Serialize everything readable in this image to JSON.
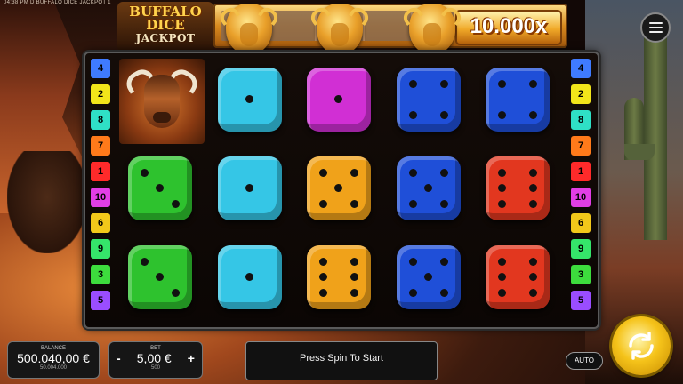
{
  "status_text": "04:38 PM  D  BUFFALO DICE JACKPOT  1",
  "logo": {
    "line1": "BUFFALO",
    "line2": "DICE",
    "line3": "JACKPOT"
  },
  "jackpot": {
    "value": "10.000x"
  },
  "paytable_left": [
    {
      "value": "4",
      "color": "#3f7bff"
    },
    {
      "value": "2",
      "color": "#f2e51a"
    },
    {
      "value": "8",
      "color": "#2fe0c6"
    },
    {
      "value": "7",
      "color": "#ff7a1a"
    },
    {
      "value": "1",
      "color": "#ff2a2a"
    },
    {
      "value": "10",
      "color": "#e23ee6"
    },
    {
      "value": "6",
      "color": "#f2c81a"
    },
    {
      "value": "9",
      "color": "#35e56a"
    },
    {
      "value": "3",
      "color": "#3ddc3d"
    },
    {
      "value": "5",
      "color": "#9a4dff"
    }
  ],
  "paytable_right": [
    {
      "value": "4",
      "color": "#3f7bff"
    },
    {
      "value": "2",
      "color": "#f2e51a"
    },
    {
      "value": "8",
      "color": "#2fe0c6"
    },
    {
      "value": "7",
      "color": "#ff7a1a"
    },
    {
      "value": "1",
      "color": "#ff2a2a"
    },
    {
      "value": "10",
      "color": "#e23ee6"
    },
    {
      "value": "6",
      "color": "#f2c81a"
    },
    {
      "value": "9",
      "color": "#35e56a"
    },
    {
      "value": "3",
      "color": "#3ddc3d"
    },
    {
      "value": "5",
      "color": "#9a4dff"
    }
  ],
  "grid": [
    [
      {
        "type": "buffalo"
      },
      {
        "type": "die",
        "color": "cyan",
        "pips": 1
      },
      {
        "type": "die",
        "color": "magenta",
        "pips": 1
      },
      {
        "type": "die",
        "color": "blue",
        "pips": 4
      },
      {
        "type": "die",
        "color": "blue",
        "pips": 4
      }
    ],
    [
      {
        "type": "die",
        "color": "green",
        "pips": 3
      },
      {
        "type": "die",
        "color": "cyan",
        "pips": 1
      },
      {
        "type": "die",
        "color": "orange",
        "pips": 5
      },
      {
        "type": "die",
        "color": "blue",
        "pips": 5
      },
      {
        "type": "die",
        "color": "red",
        "pips": 6
      }
    ],
    [
      {
        "type": "die",
        "color": "green",
        "pips": 3
      },
      {
        "type": "die",
        "color": "cyan",
        "pips": 1
      },
      {
        "type": "die",
        "color": "orange",
        "pips": 6
      },
      {
        "type": "die",
        "color": "blue",
        "pips": 5
      },
      {
        "type": "die",
        "color": "red",
        "pips": 6
      }
    ]
  ],
  "die_colors": {
    "cyan": "#35c6e6",
    "magenta": "#d12fd4",
    "blue": "#1f4fd8",
    "green": "#2ec22e",
    "orange": "#f0a21a",
    "red": "#e2371f"
  },
  "balance": {
    "label": "BALANCE",
    "value": "500.040,00 €",
    "sub": "50.004.000"
  },
  "bet": {
    "label": "BET",
    "minus": "-",
    "value": "5,00 €",
    "plus": "+",
    "sub": "500"
  },
  "message": "Press Spin To Start",
  "auto_label": "AUTO"
}
